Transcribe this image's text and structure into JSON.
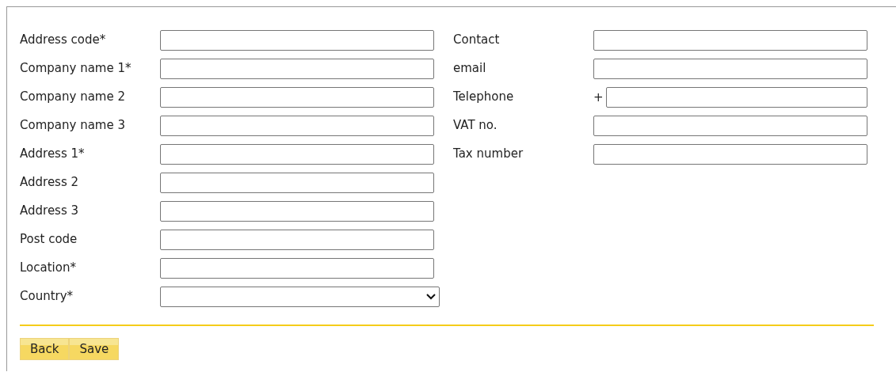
{
  "left_fields": [
    {
      "label": "Address code*",
      "kind": "text"
    },
    {
      "label": "Company name 1*",
      "kind": "text"
    },
    {
      "label": "Company name 2",
      "kind": "text"
    },
    {
      "label": "Company name 3",
      "kind": "text"
    },
    {
      "label": "Address 1*",
      "kind": "text"
    },
    {
      "label": "Address 2",
      "kind": "text"
    },
    {
      "label": "Address 3",
      "kind": "text"
    },
    {
      "label": "Post code",
      "kind": "text"
    },
    {
      "label": "Location*",
      "kind": "text"
    },
    {
      "label": "Country*",
      "kind": "select"
    }
  ],
  "right_fields": [
    {
      "label": "Contact",
      "kind": "text"
    },
    {
      "label": "email",
      "kind": "text"
    },
    {
      "label": "Telephone",
      "kind": "phone",
      "prefix": "+"
    },
    {
      "label": "VAT no.",
      "kind": "text"
    },
    {
      "label": "Tax number",
      "kind": "text"
    }
  ],
  "buttons": [
    "Back",
    "Save"
  ]
}
